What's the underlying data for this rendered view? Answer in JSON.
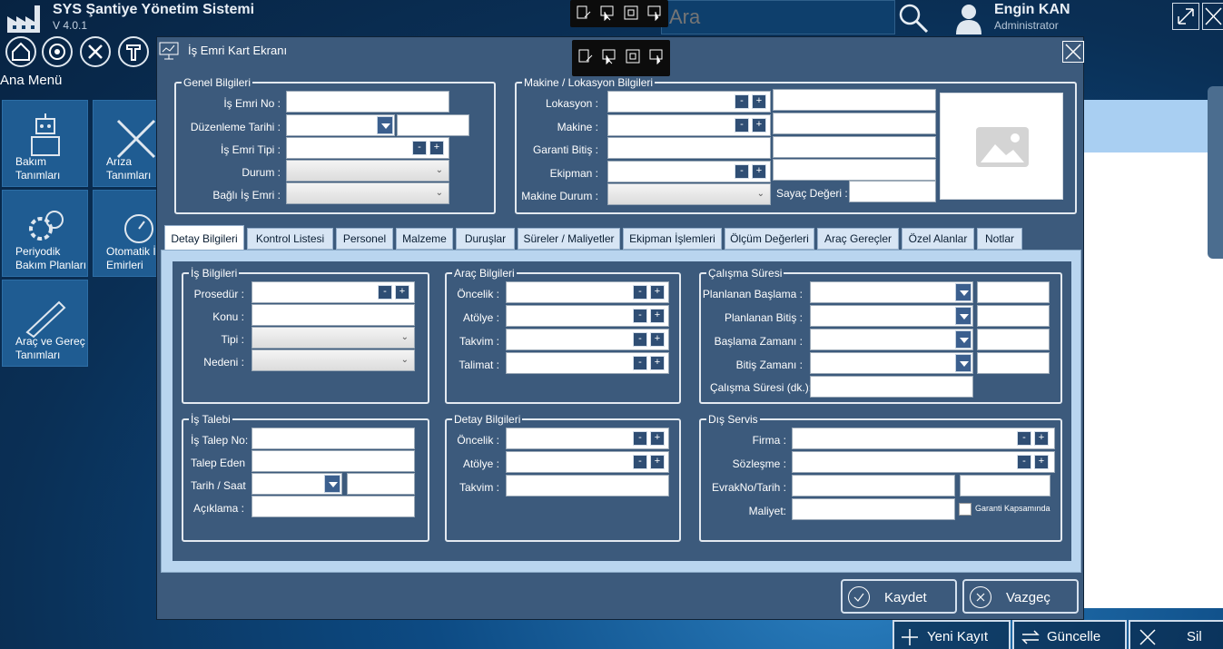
{
  "app": {
    "title": "SYS Şantiye Yönetim Sistemi",
    "version": "V 4.0.1"
  },
  "search": {
    "placeholder": "Ara"
  },
  "user": {
    "name": "Engin KAN",
    "role": "Administrator"
  },
  "menu": {
    "title": "Ana Menü",
    "tiles": [
      {
        "label": "Bakım\nTanımları",
        "icon": "robot-icon"
      },
      {
        "label": "Arıza\nTanımları",
        "icon": "tools-icon"
      },
      {
        "label": "Periyodik\nBakım Planları",
        "icon": "gear-clock-icon"
      },
      {
        "label": "Otomatik İş\nEmirleri",
        "icon": "stopwatch-icon"
      },
      {
        "label": "Araç ve Gereç\nTanımları",
        "icon": "drill-icon"
      }
    ]
  },
  "modal": {
    "title": "İş Emri Kart Ekranı",
    "genel": {
      "legend": "Genel Bilgileri",
      "is_emri_no": "İş Emri No :",
      "duzenleme_tarihi": "Düzenleme Tarihi :",
      "is_emri_tipi": "İş Emri Tipi :",
      "durum": "Durum :",
      "bagli_is_emri": "Bağlı İş Emri :"
    },
    "makine": {
      "legend": "Makine / Lokasyon Bilgileri",
      "lokasyon": "Lokasyon :",
      "makine": "Makine :",
      "garanti_bitis": "Garanti Bitiş :",
      "ekipman": "Ekipman :",
      "makine_durum": "Makine Durum :",
      "sayac_degeri": "Sayaç Değeri :"
    },
    "tabs": [
      "Detay Bilgileri",
      "Kontrol Listesi",
      "Personel",
      "Malzeme",
      "Duruşlar",
      "Süreler / Maliyetler",
      "Ekipman İşlemleri",
      "Ölçüm Değerleri",
      "Araç Gereçler",
      "Özel Alanlar",
      "Notlar"
    ],
    "is_bilgileri": {
      "legend": "İş Bilgileri",
      "prosedur": "Prosedür :",
      "konu": "Konu :",
      "tipi": "Tipi :",
      "nedeni": "Nedeni :"
    },
    "arac_bilgileri": {
      "legend": "Araç Bilgileri",
      "oncelik": "Öncelik :",
      "atolye": "Atölye :",
      "takvim": "Takvim :",
      "talimat": "Talimat :"
    },
    "calisma_suresi": {
      "legend": "Çalışma Süresi",
      "planlanan_baslama": "Planlanan Başlama :",
      "planlanan_bitis": "Planlanan Bitiş :",
      "baslama_zamani": "Başlama Zamanı :",
      "bitis_zamani": "Bitiş Zamanı :",
      "calisma_suresi_dk": "Çalışma Süresi (dk.):"
    },
    "is_talebi": {
      "legend": "İş Talebi",
      "talep_no": "İş Talep No:",
      "talep_eden": "Talep Eden",
      "tarih_saat": "Tarih / Saat",
      "aciklama": "Açıklama :"
    },
    "detay_bilgileri": {
      "legend": "Detay Bilgileri",
      "oncelik": "Öncelik :",
      "atolye": "Atölye :",
      "takvim": "Takvim :"
    },
    "dis_servis": {
      "legend": "Dış Servis",
      "firma": "Firma :",
      "sozlesme": "Sözleşme :",
      "evrak": "EvrakNo/Tarih :",
      "maliyet": "Maliyet:",
      "garanti": "Garanti Kapsamında"
    },
    "buttons": {
      "save": "Kaydet",
      "cancel": "Vazgeç"
    }
  },
  "bottom": {
    "new": "Yeni Kayıt",
    "update": "Güncelle",
    "delete": "Sil"
  },
  "colors": {
    "accent": "#3c5a7c",
    "tab_active": "#ffffff"
  }
}
